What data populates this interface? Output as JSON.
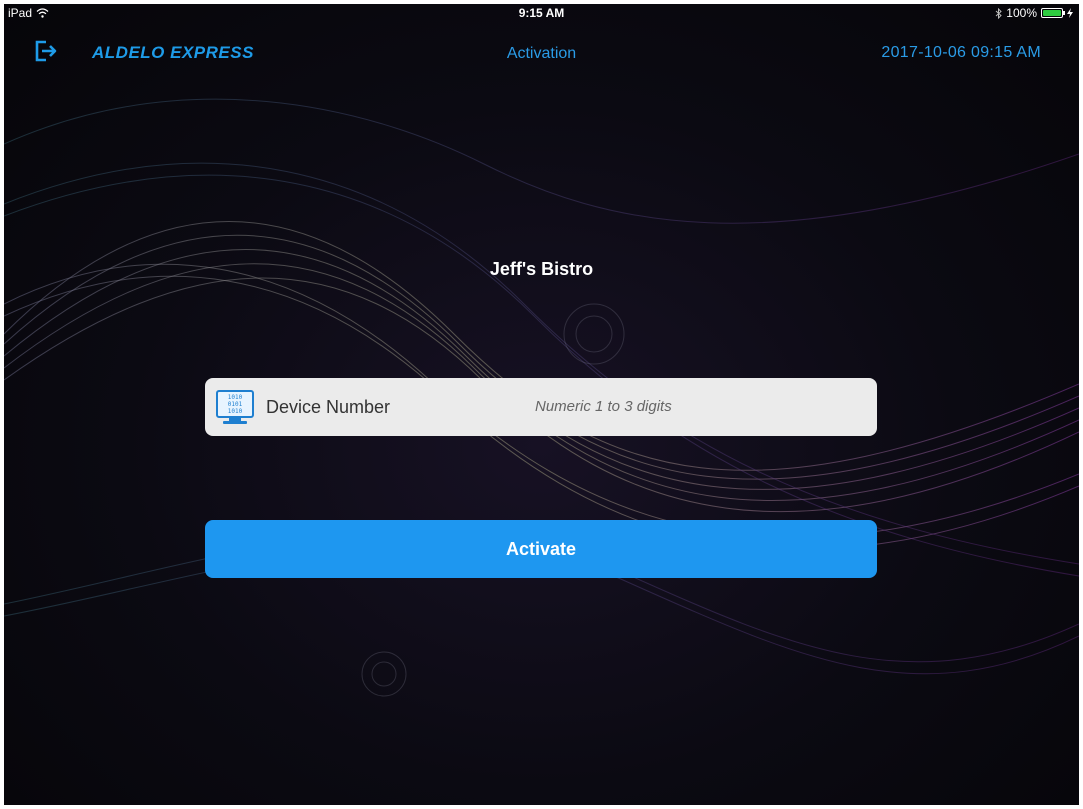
{
  "status_bar": {
    "device": "iPad",
    "time": "9:15 AM",
    "battery_percent": "100%",
    "battery_level": 1.0,
    "icons": [
      "wifi-icon",
      "bluetooth-icon",
      "battery-icon",
      "charging-icon"
    ]
  },
  "navbar": {
    "logout_icon": "logout-icon",
    "brand": "ALDELO EXPRESS",
    "title": "Activation",
    "datetime": "2017-10-06 09:15 AM"
  },
  "restaurant_name": "Jeff's Bistro",
  "device_field": {
    "icon": "binary-monitor-icon",
    "label": "Device Number",
    "value": "",
    "placeholder": "Numeric 1 to 3 digits"
  },
  "activate_label": "Activate",
  "colors": {
    "accent": "#1e97f0",
    "nav_text": "#2a9be6",
    "field_bg": "#ebebeb",
    "background": "#0b0a12",
    "battery": "#2ecc40"
  }
}
